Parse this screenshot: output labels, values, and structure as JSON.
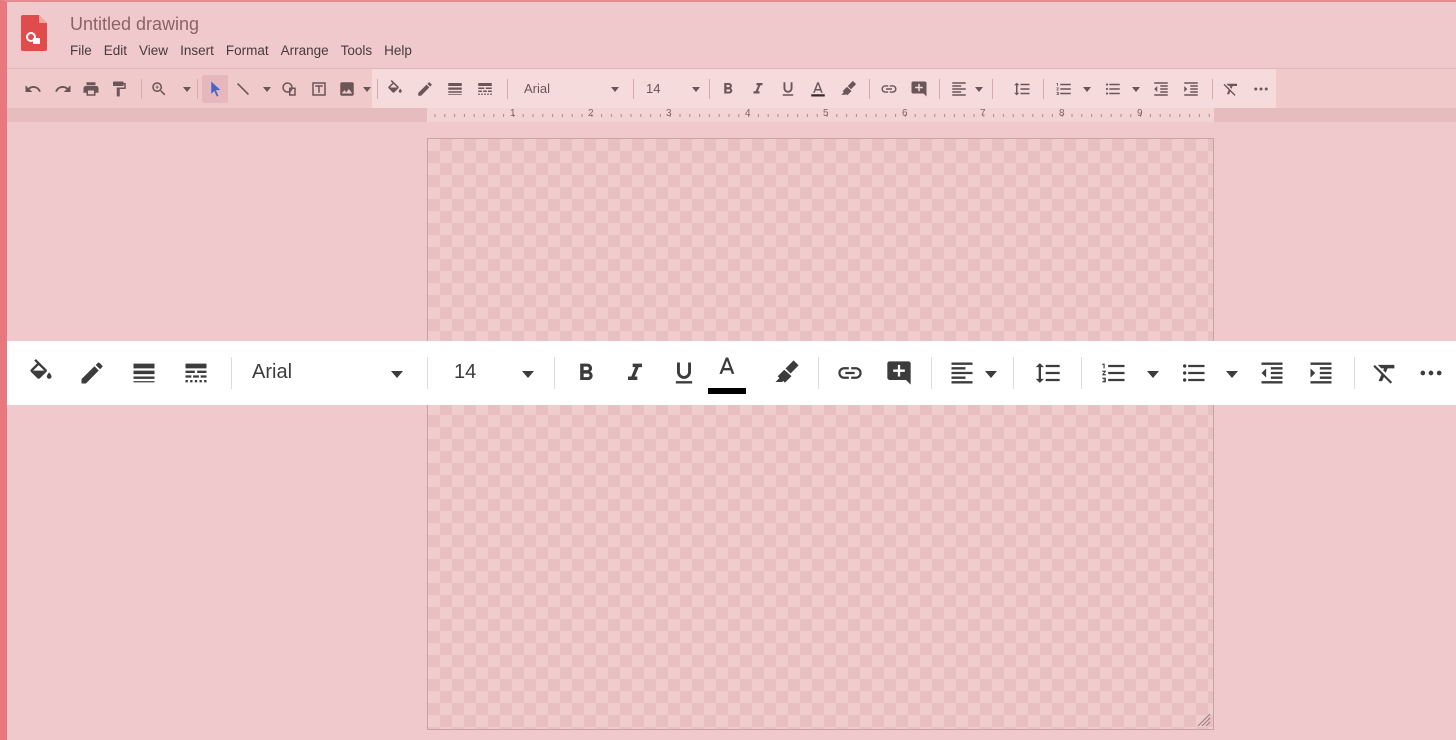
{
  "app": {
    "title": "Untitled drawing",
    "logo_icon": "google-drawings-logo",
    "accent_color": "#e04b4b"
  },
  "menu": [
    {
      "label": "File"
    },
    {
      "label": "Edit"
    },
    {
      "label": "View"
    },
    {
      "label": "Insert"
    },
    {
      "label": "Format"
    },
    {
      "label": "Arrange"
    },
    {
      "label": "Tools"
    },
    {
      "label": "Help"
    }
  ],
  "toolbar": {
    "font": "Arial",
    "font_size": "14"
  },
  "ruler": {
    "marks": [
      "1",
      "2",
      "3",
      "4",
      "5",
      "6",
      "7",
      "8",
      "9"
    ]
  },
  "text_color": "#000000"
}
